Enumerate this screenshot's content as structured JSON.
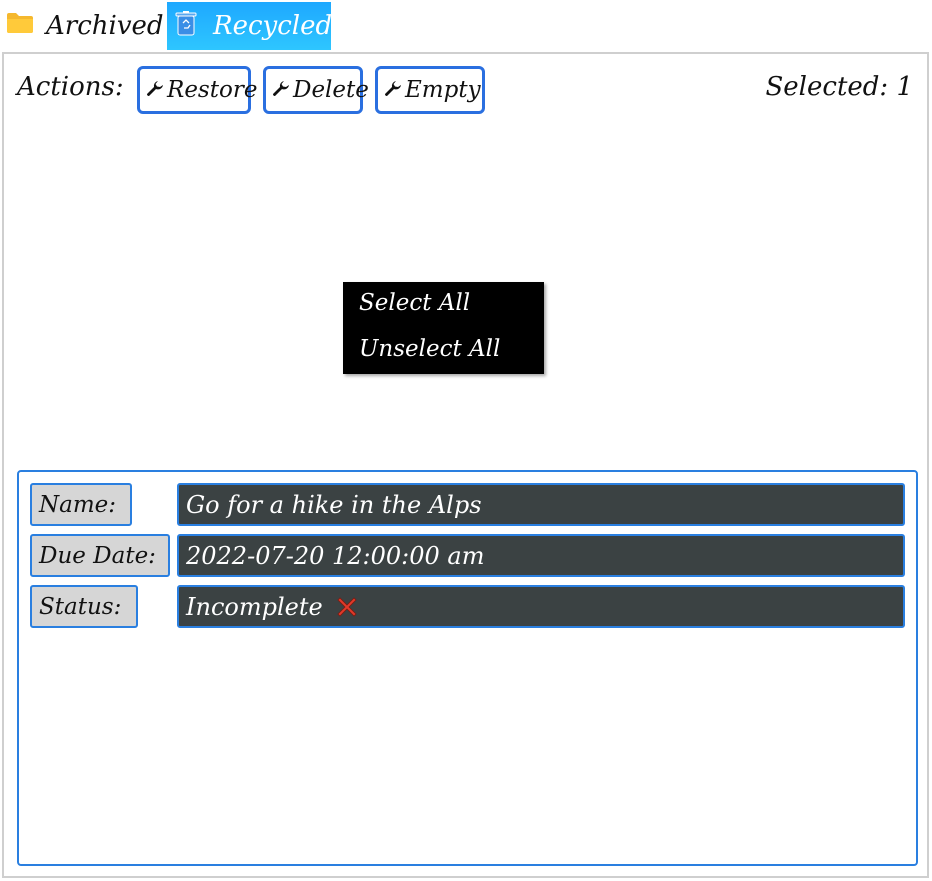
{
  "tabs": [
    {
      "label": "Archived",
      "icon": "folder-icon",
      "active": false
    },
    {
      "label": "Recycled",
      "icon": "recycle-bin-icon",
      "active": true
    }
  ],
  "toolbar": {
    "actions_label": "Actions:",
    "restore_label": "Restore",
    "delete_label": "Delete",
    "empty_label": "Empty",
    "selected_text": "Selected: 1"
  },
  "context_menu": {
    "items": [
      "Select All",
      "Unselect All"
    ]
  },
  "details": {
    "name_label": "Name:",
    "name_value": "Go for a hike in the Alps",
    "due_label": "Due Date:",
    "due_value": "2022-07-20 12:00:00 am",
    "status_label": "Status:",
    "status_value": "Incomplete",
    "status_icon": "red-x-icon"
  },
  "colors": {
    "accent": "#2a7fe0",
    "active_tab": "#1ea8ff",
    "field_bg": "#3b4243",
    "label_bg": "#d6d6d6",
    "menu_bg": "#000000",
    "status_x": "#e03a2a"
  }
}
